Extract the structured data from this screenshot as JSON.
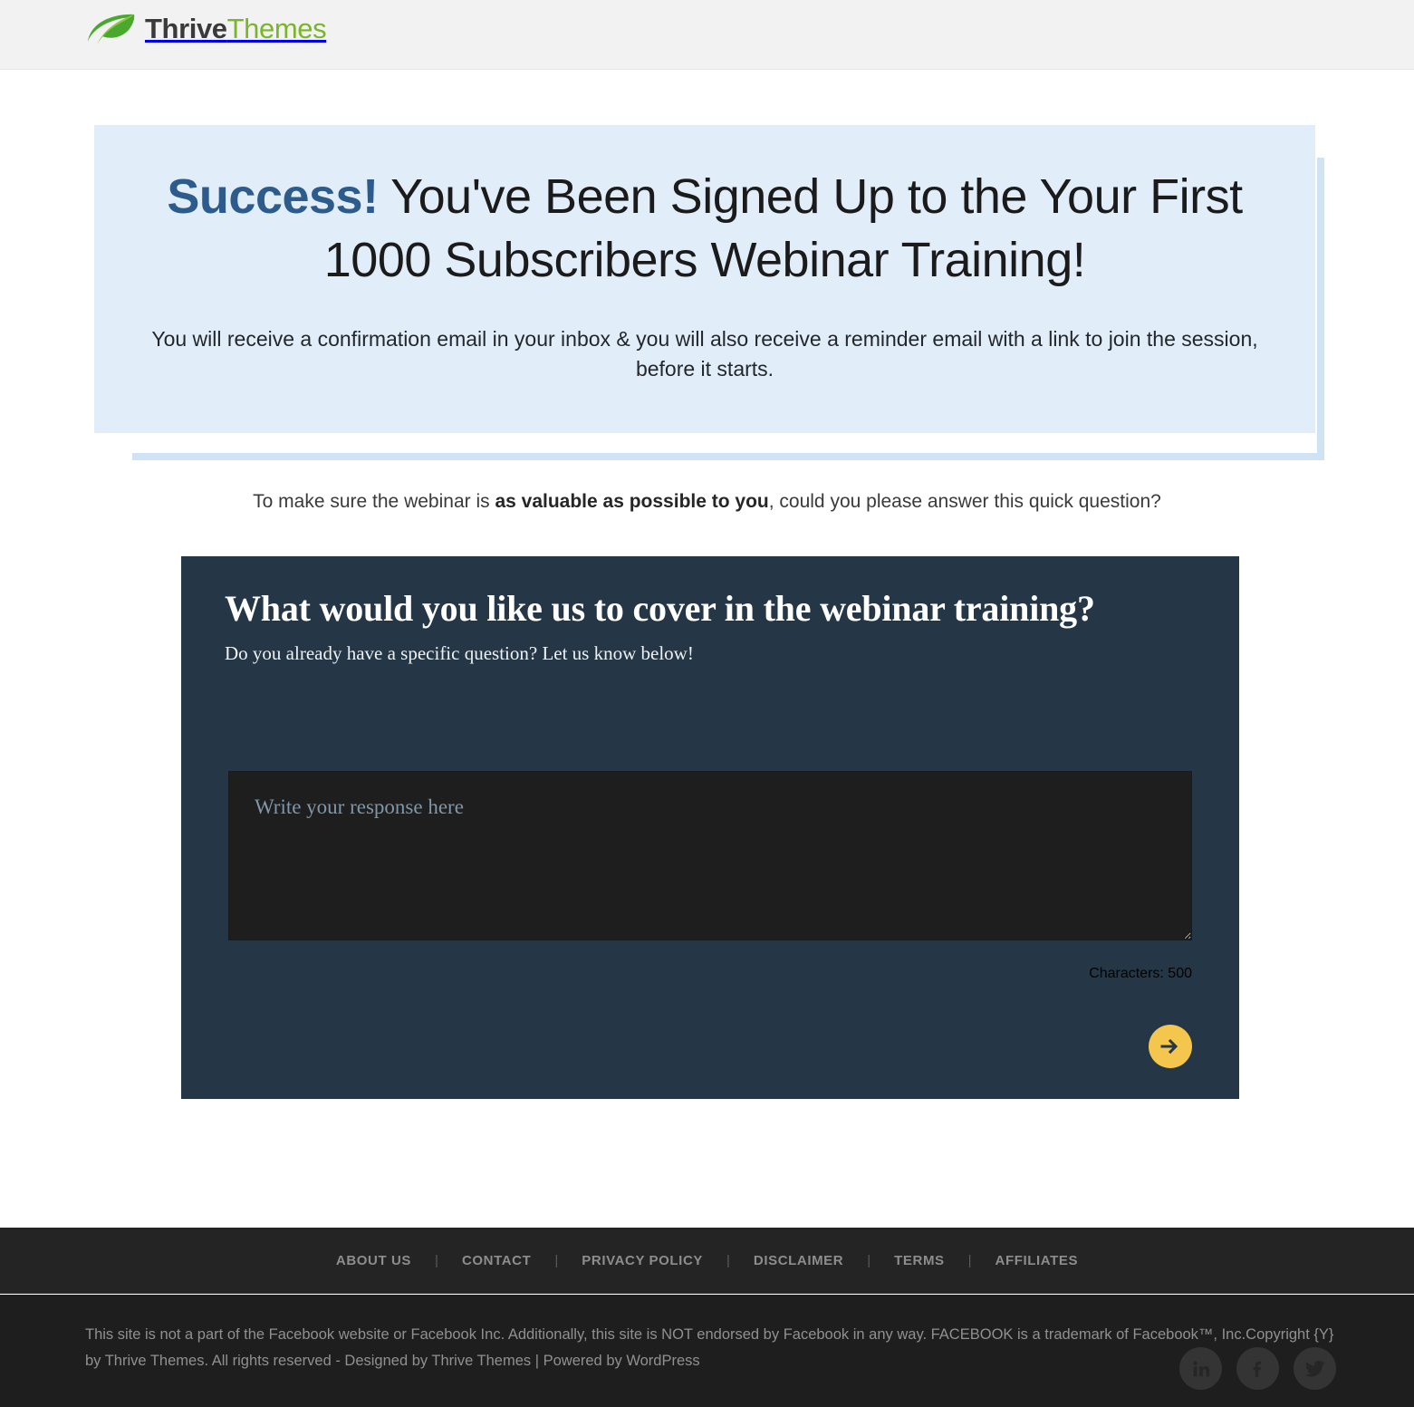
{
  "header": {
    "logo_icon": "leaf-icon",
    "logo_primary": "Thrive",
    "logo_secondary": "Themes",
    "brand_green": "#7ab52a",
    "bar_color": "#f2f2f2"
  },
  "hero": {
    "highlight": "Success!",
    "headline": " You've Been Signed Up to the Your First 1000 Subscribers Webinar Training!",
    "subtext": "You will receive a confirmation email in your inbox & you will also receive a reminder email with a link to join the session, before it starts.",
    "box_color": "#e1eefa",
    "shadow_color": "#cfe3f5",
    "highlight_color": "#2d5b8c"
  },
  "intro": {
    "before": "To make sure the webinar is ",
    "bold": "as valuable as possible to you",
    "after": ", could you please answer this quick question?"
  },
  "survey": {
    "title": "What would you like us to cover in the webinar training?",
    "subtitle": "Do you already have a specific question? Let us know below!",
    "response_value": "",
    "response_placeholder": "Write your response here",
    "character_count": "Characters: 500",
    "submit_icon": "arrow-right-icon",
    "card_color": "#253746",
    "accent_color": "#f4c64d"
  },
  "footer": {
    "links": [
      {
        "label": "ABOUT US"
      },
      {
        "label": "CONTACT"
      },
      {
        "label": "PRIVACY POLICY"
      },
      {
        "label": "DISCLAIMER"
      },
      {
        "label": "TERMS"
      },
      {
        "label": "AFFILIATES"
      }
    ],
    "separator": "|",
    "legal_line_1": "This site is not a part of the Facebook website or Facebook Inc. Additionally, this site is NOT endorsed by Facebook in any way. FACEBOOK is a trademark of Facebook™, Inc.Copyright",
    "legal_line_2": "{Y} by Thrive Themes. All rights reserved   -   Designed by Thrive Themes | Powered by WordPress",
    "socials": [
      {
        "name": "linkedin",
        "glyph": "in"
      },
      {
        "name": "facebook",
        "glyph": "f"
      },
      {
        "name": "twitter",
        "glyph": "•"
      }
    ]
  }
}
